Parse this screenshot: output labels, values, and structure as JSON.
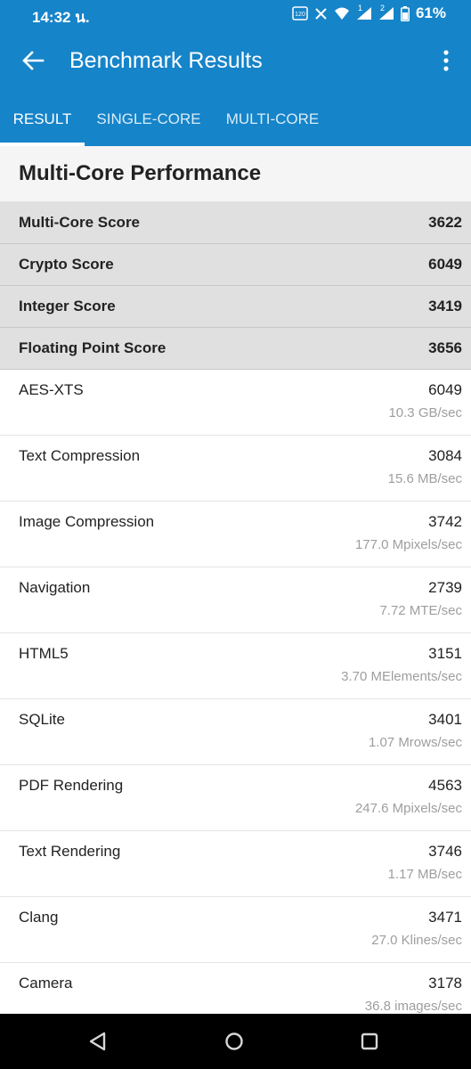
{
  "status": {
    "time": "14:32 น.",
    "battery": "61%",
    "icons": [
      "refresh-rate-120hz-icon",
      "x-app-icon",
      "wifi-icon",
      "signal-sim1-icon",
      "signal-sim2-icon",
      "battery-icon"
    ],
    "sim1_badge": "1",
    "sim2_badge": "2"
  },
  "appbar": {
    "title": "Benchmark Results"
  },
  "tabs": [
    {
      "label": "RESULT",
      "active": true
    },
    {
      "label": "SINGLE-CORE",
      "active": false
    },
    {
      "label": "MULTI-CORE",
      "active": false
    }
  ],
  "section": {
    "title": "Multi-Core Performance"
  },
  "scores": [
    {
      "label": "Multi-Core Score",
      "value": "3622"
    },
    {
      "label": "Crypto Score",
      "value": "6049"
    },
    {
      "label": "Integer Score",
      "value": "3419"
    },
    {
      "label": "Floating Point Score",
      "value": "3656"
    }
  ],
  "benchmarks": [
    {
      "name": "AES-XTS",
      "score": "6049",
      "rate": "10.3 GB/sec"
    },
    {
      "name": "Text Compression",
      "score": "3084",
      "rate": "15.6 MB/sec"
    },
    {
      "name": "Image Compression",
      "score": "3742",
      "rate": "177.0 Mpixels/sec"
    },
    {
      "name": "Navigation",
      "score": "2739",
      "rate": "7.72 MTE/sec"
    },
    {
      "name": "HTML5",
      "score": "3151",
      "rate": "3.70 MElements/sec"
    },
    {
      "name": "SQLite",
      "score": "3401",
      "rate": "1.07 Mrows/sec"
    },
    {
      "name": "PDF Rendering",
      "score": "4563",
      "rate": "247.6 Mpixels/sec"
    },
    {
      "name": "Text Rendering",
      "score": "3746",
      "rate": "1.17 MB/sec"
    },
    {
      "name": "Clang",
      "score": "3471",
      "rate": "27.0 Klines/sec"
    },
    {
      "name": "Camera",
      "score": "3178",
      "rate": "36.8 images/sec"
    }
  ],
  "navbar": {
    "icons": [
      "back-triangle-icon",
      "home-circle-icon",
      "recents-square-icon"
    ]
  },
  "colors": {
    "primary": "#1684c9",
    "score_row_bg": "#e0e0e0",
    "rate_text": "#9e9e9e",
    "navbar": "#000000"
  }
}
